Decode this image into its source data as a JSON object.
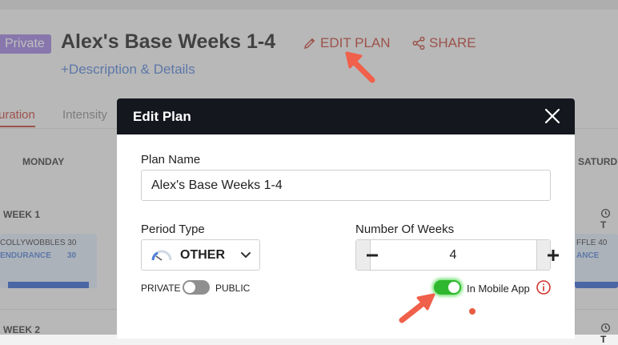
{
  "header": {
    "badge": "Private",
    "plan_title": "Alex's Base Weeks 1-4",
    "edit_plan_label": "EDIT PLAN",
    "share_label": "SHARE",
    "description_link": "+Description & Details"
  },
  "tabs": [
    {
      "label": "uration"
    },
    {
      "label": "Intensity"
    }
  ],
  "calendar": {
    "days": [
      "MONDAY",
      "SATURD"
    ],
    "weeks": [
      "WEEK 1",
      "WEEK 2"
    ],
    "time_label": "T",
    "left_card": {
      "title": "COLLYWOBBLES 30",
      "type": "ENDURANCE",
      "duration": "30"
    },
    "right_card": {
      "title": "FFLE 40",
      "type": "ANCE"
    }
  },
  "modal": {
    "title": "Edit Plan",
    "plan_name_label": "Plan Name",
    "plan_name_value": "Alex's Base Weeks 1-4",
    "period_type_label": "Period Type",
    "period_type_value": "OTHER",
    "weeks_label": "Number Of Weeks",
    "weeks_value": "4",
    "private_label": "PRIVATE",
    "public_label": "PUBLIC",
    "visibility_public": false,
    "mobile_app_label": "In Mobile App",
    "mobile_app_enabled": true
  },
  "colors": {
    "accent_red": "#c23b2e",
    "link_blue": "#4d7fd6",
    "badge_purple": "#9b7fe0",
    "toggle_on": "#2fb82f",
    "modal_header": "#15171f"
  },
  "icons": [
    "pencil-icon",
    "share-icon",
    "close-icon",
    "gauge-icon",
    "chevron-down-icon",
    "minus-icon",
    "plus-icon",
    "info-icon",
    "clock-icon"
  ]
}
